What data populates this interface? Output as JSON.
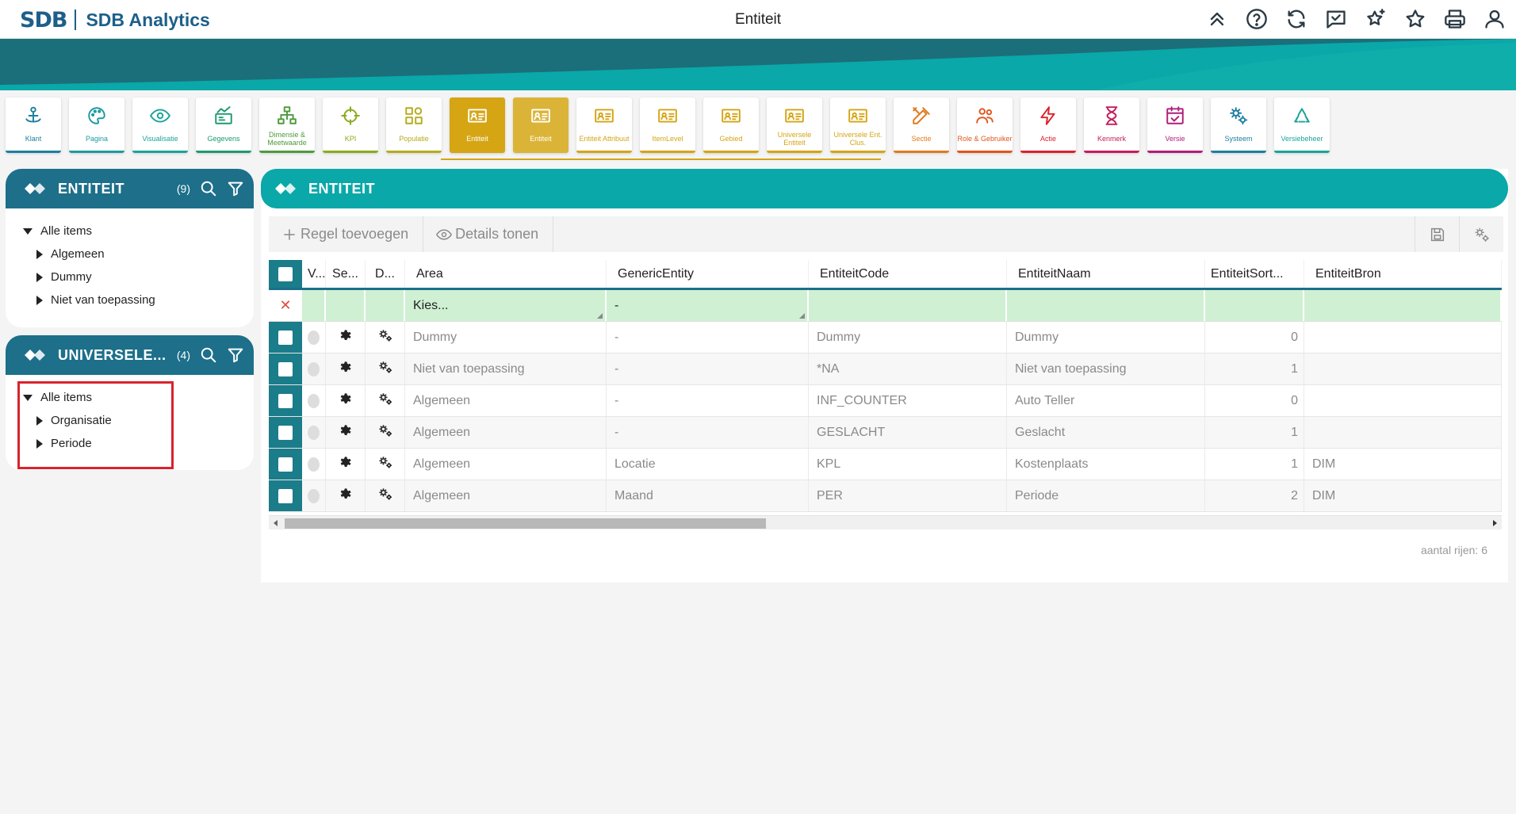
{
  "app": {
    "logo_mark": "SDB",
    "name": "SDB Analytics",
    "page_title": "Entiteit"
  },
  "header_icons": [
    "chevrons-up-icon",
    "help-circle-icon",
    "refresh-icon",
    "chat-check-icon",
    "sparkle-star-icon",
    "star-icon",
    "printer-icon",
    "user-icon"
  ],
  "colors": {
    "teal": "#0aa8a8",
    "dark_teal": "#1d6f8a",
    "gold_active": "#d5a514",
    "filter_row": "#cff0d2",
    "red_highlight": "#d9232d"
  },
  "modules": [
    {
      "label": "Klant",
      "icon": "anchor-person-icon",
      "color": "#1d7fa0"
    },
    {
      "label": "Pagina",
      "icon": "palette-icon",
      "color": "#1d9aa0"
    },
    {
      "label": "Visualisatie",
      "icon": "eye-icon",
      "color": "#1aa39a"
    },
    {
      "label": "Gegevens",
      "icon": "chart-card-icon",
      "color": "#1d9a6f"
    },
    {
      "label": "Dimensie & Meetwaarde",
      "icon": "cube-tree-icon",
      "color": "#4e9a3d"
    },
    {
      "label": "KPI",
      "icon": "crosshair-icon",
      "color": "#8aaa1d"
    },
    {
      "label": "Populatie",
      "icon": "grid-shapes-icon",
      "color": "#b5ac1d"
    },
    {
      "label": "Entiteit",
      "icon": "id-card-icon",
      "color": "#ffffff"
    },
    {
      "label": "Entiteit",
      "icon": "id-card-icon",
      "color": "#ffffff"
    },
    {
      "label": "Entiteit Attribuut",
      "icon": "id-card-icon",
      "color": "#d5a514"
    },
    {
      "label": "ItemLevel",
      "icon": "id-card-icon",
      "color": "#d5a514"
    },
    {
      "label": "Gebied",
      "icon": "id-card-icon",
      "color": "#d5a514"
    },
    {
      "label": "Universele Entiteit",
      "icon": "id-card-icon",
      "color": "#d5a514"
    },
    {
      "label": "Universele Ent. Clus.",
      "icon": "id-card-icon",
      "color": "#d5a514"
    },
    {
      "label": "Sectie",
      "icon": "pencil-ruler-icon",
      "color": "#e07a1d"
    },
    {
      "label": "Role & Gebruiker",
      "icon": "users-icon",
      "color": "#e0561d"
    },
    {
      "label": "Actie",
      "icon": "lightning-icon",
      "color": "#d9232d"
    },
    {
      "label": "Kenmerk",
      "icon": "hourglass-icon",
      "color": "#c21d5a"
    },
    {
      "label": "Versie",
      "icon": "calendar-check-icon",
      "color": "#b01d7a"
    },
    {
      "label": "Systeem",
      "icon": "gears-icon",
      "color": "#1d7fa0"
    },
    {
      "label": "Versiebeheer",
      "icon": "recycle-icon",
      "color": "#1aa39a"
    }
  ],
  "left_panels": [
    {
      "title": "ENTITEIT",
      "count": "(9)",
      "tree": [
        {
          "label": "Alle items",
          "expanded": true,
          "level": 0
        },
        {
          "label": "Algemeen",
          "expanded": false,
          "level": 1
        },
        {
          "label": "Dummy",
          "expanded": false,
          "level": 1
        },
        {
          "label": "Niet van toepassing",
          "expanded": false,
          "level": 1
        }
      ]
    },
    {
      "title": "UNIVERSELE...",
      "count": "(4)",
      "tree": [
        {
          "label": "Alle items",
          "expanded": true,
          "level": 0
        },
        {
          "label": "Organisatie",
          "expanded": false,
          "level": 1
        },
        {
          "label": "Periode",
          "expanded": false,
          "level": 1
        }
      ]
    }
  ],
  "main": {
    "title": "ENTITEIT",
    "toolbar": {
      "add_row": "Regel toevoegen",
      "show_details": "Details tonen"
    },
    "columns": [
      "V...",
      "Se...",
      "D...",
      "Area",
      "GenericEntity",
      "EntiteitCode",
      "EntiteitNaam",
      "EntiteitSort...",
      "EntiteitBron"
    ],
    "filter_row": {
      "area": "Kies...",
      "generic_entity": "-"
    },
    "rows": [
      {
        "area": "Dummy",
        "generic_entity": "-",
        "code": "Dummy",
        "naam": "Dummy",
        "sort": "0",
        "bron": ""
      },
      {
        "area": "Niet van toepassing",
        "generic_entity": "-",
        "code": "*NA",
        "naam": "Niet van toepassing",
        "sort": "1",
        "bron": ""
      },
      {
        "area": "Algemeen",
        "generic_entity": "-",
        "code": "INF_COUNTER",
        "naam": "Auto Teller",
        "sort": "0",
        "bron": ""
      },
      {
        "area": "Algemeen",
        "generic_entity": "-",
        "code": "GESLACHT",
        "naam": "Geslacht",
        "sort": "1",
        "bron": ""
      },
      {
        "area": "Algemeen",
        "generic_entity": "Locatie",
        "code": "KPL",
        "naam": "Kostenplaats",
        "sort": "1",
        "bron": "DIM"
      },
      {
        "area": "Algemeen",
        "generic_entity": "Maand",
        "code": "PER",
        "naam": "Periode",
        "sort": "2",
        "bron": "DIM"
      }
    ],
    "row_count": "aantal rijen: 6"
  }
}
